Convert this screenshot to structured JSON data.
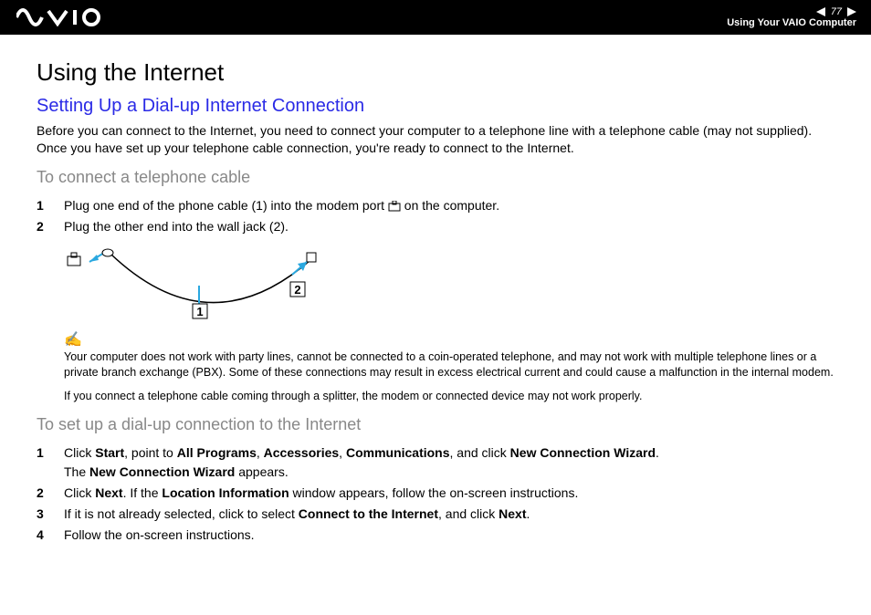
{
  "header": {
    "page_number": "77",
    "section": "Using Your VAIO Computer"
  },
  "main": {
    "title": "Using the Internet",
    "subtitle": "Setting Up a Dial-up Internet Connection",
    "intro": "Before you can connect to the Internet, you need to connect your computer to a telephone line with a telephone cable (may not supplied). Once you have set up your telephone cable connection, you're ready to connect to the Internet.",
    "section1_heading": "To connect a telephone cable",
    "section1_steps": [
      {
        "n": "1",
        "pre": "Plug one end of the phone cable (1) into the modem port ",
        "post": " on the computer."
      },
      {
        "n": "2",
        "pre": "Plug the other end into the wall jack (2).",
        "post": ""
      }
    ],
    "figure": {
      "label1": "1",
      "label2": "2"
    },
    "note1": "Your computer does not work with party lines, cannot be connected to a coin-operated telephone, and may not work with multiple telephone lines or a private branch exchange (PBX). Some of these connections may result in excess electrical current and could cause a malfunction in the internal modem.",
    "note2": "If you connect a telephone cable coming through a splitter, the modem or connected device may not work properly.",
    "section2_heading": "To set up a dial-up connection to the Internet",
    "section2_steps": [
      {
        "n": "1",
        "t1": "Click ",
        "b1": "Start",
        "t2": ", point to ",
        "b2": "All Programs",
        "t3": ", ",
        "b3": "Accessories",
        "t4": ", ",
        "b4": "Communications",
        "t5": ", and click ",
        "b5": "New Connection Wizard",
        "t6": ".",
        "line2a": "The ",
        "line2b": "New Connection Wizard",
        "line2c": " appears."
      },
      {
        "n": "2",
        "t1": "Click ",
        "b1": "Next",
        "t2": ". If the ",
        "b2": "Location Information",
        "t3": " window appears, follow the on-screen instructions."
      },
      {
        "n": "3",
        "t1": "If it is not already selected, click to select ",
        "b1": "Connect to the Internet",
        "t2": ", and click ",
        "b2": "Next",
        "t3": "."
      },
      {
        "n": "4",
        "t1": "Follow the on-screen instructions."
      }
    ]
  }
}
